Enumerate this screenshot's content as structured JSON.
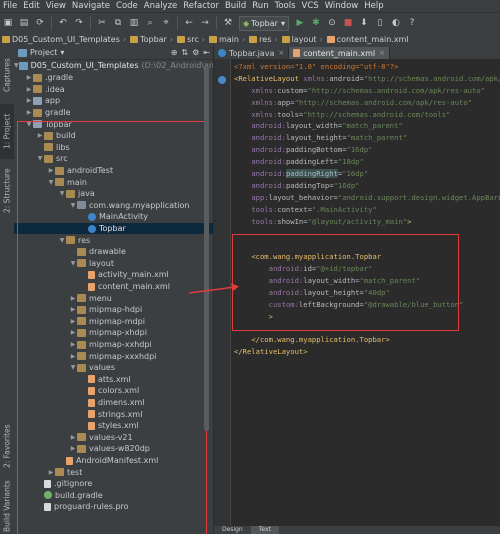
{
  "menubar": [
    "File",
    "Edit",
    "View",
    "Navigate",
    "Code",
    "Analyze",
    "Refactor",
    "Build",
    "Run",
    "Tools",
    "VCS",
    "Window",
    "Help"
  ],
  "toolbar": {
    "run_config": "Topbar"
  },
  "breadcrumbs": [
    "D05_Custom_UI_Templates",
    "Topbar",
    "src",
    "main",
    "res",
    "layout",
    "content_main.xml"
  ],
  "sidebar_tabs": [
    "Captures",
    "1: Project",
    "2: Structure",
    "2: Favorites",
    "Build Variants"
  ],
  "project_panel": {
    "header": "Project",
    "root": "D05_Custom_UI_Templates",
    "root_path": "(D:\\02_Android\\andr",
    "items": [
      {
        "label": ".gradle",
        "indent": 1,
        "open": false,
        "icon": "folder"
      },
      {
        "label": ".idea",
        "indent": 1,
        "open": false,
        "icon": "folder"
      },
      {
        "label": "app",
        "indent": 1,
        "open": false,
        "icon": "modfolder"
      },
      {
        "label": "gradle",
        "indent": 1,
        "open": false,
        "icon": "folder"
      },
      {
        "label": "Topbar",
        "indent": 1,
        "open": true,
        "icon": "modfolder"
      },
      {
        "label": "build",
        "indent": 2,
        "open": false,
        "icon": "folder"
      },
      {
        "label": "libs",
        "indent": 2,
        "open": null,
        "icon": "folder"
      },
      {
        "label": "src",
        "indent": 2,
        "open": true,
        "icon": "folder"
      },
      {
        "label": "androidTest",
        "indent": 3,
        "open": false,
        "icon": "folder"
      },
      {
        "label": "main",
        "indent": 3,
        "open": true,
        "icon": "folder"
      },
      {
        "label": "java",
        "indent": 4,
        "open": true,
        "icon": "folder"
      },
      {
        "label": "com.wang.myapplication",
        "indent": 5,
        "open": true,
        "icon": "pkg"
      },
      {
        "label": "MainActivity",
        "indent": 6,
        "open": null,
        "icon": "cls"
      },
      {
        "label": "Topbar",
        "indent": 6,
        "open": null,
        "icon": "cls",
        "selected": true
      },
      {
        "label": "res",
        "indent": 4,
        "open": true,
        "icon": "folder"
      },
      {
        "label": "drawable",
        "indent": 5,
        "open": null,
        "icon": "folder"
      },
      {
        "label": "layout",
        "indent": 5,
        "open": true,
        "icon": "folder"
      },
      {
        "label": "activity_main.xml",
        "indent": 6,
        "open": null,
        "icon": "xml"
      },
      {
        "label": "content_main.xml",
        "indent": 6,
        "open": null,
        "icon": "xml"
      },
      {
        "label": "menu",
        "indent": 5,
        "open": false,
        "icon": "folder"
      },
      {
        "label": "mipmap-hdpi",
        "indent": 5,
        "open": false,
        "icon": "folder"
      },
      {
        "label": "mipmap-mdpi",
        "indent": 5,
        "open": false,
        "icon": "folder"
      },
      {
        "label": "mipmap-xhdpi",
        "indent": 5,
        "open": false,
        "icon": "folder"
      },
      {
        "label": "mipmap-xxhdpi",
        "indent": 5,
        "open": false,
        "icon": "folder"
      },
      {
        "label": "mipmap-xxxhdpi",
        "indent": 5,
        "open": false,
        "icon": "folder"
      },
      {
        "label": "values",
        "indent": 5,
        "open": true,
        "icon": "folder"
      },
      {
        "label": "atts.xml",
        "indent": 6,
        "open": null,
        "icon": "xml"
      },
      {
        "label": "colors.xml",
        "indent": 6,
        "open": null,
        "icon": "xml"
      },
      {
        "label": "dimens.xml",
        "indent": 6,
        "open": null,
        "icon": "xml"
      },
      {
        "label": "strings.xml",
        "indent": 6,
        "open": null,
        "icon": "xml"
      },
      {
        "label": "styles.xml",
        "indent": 6,
        "open": null,
        "icon": "xml"
      },
      {
        "label": "values-v21",
        "indent": 5,
        "open": false,
        "icon": "folder"
      },
      {
        "label": "values-w820dp",
        "indent": 5,
        "open": false,
        "icon": "folder"
      },
      {
        "label": "AndroidManifest.xml",
        "indent": 4,
        "open": null,
        "icon": "xml"
      },
      {
        "label": "test",
        "indent": 3,
        "open": false,
        "icon": "folder"
      },
      {
        "label": ".gitignore",
        "indent": 2,
        "open": null,
        "icon": "file"
      },
      {
        "label": "build.gradle",
        "indent": 2,
        "open": null,
        "icon": "gradle"
      },
      {
        "label": "proguard-rules.pro",
        "indent": 2,
        "open": null,
        "icon": "file"
      }
    ]
  },
  "editor": {
    "tabs": [
      {
        "label": "Topbar.java",
        "active": false
      },
      {
        "label": "content_main.xml",
        "active": true
      }
    ],
    "lines": [
      [
        [
          "pi",
          "<?xml version=\"1.0\" encoding=\"utf-8\"?>"
        ]
      ],
      [
        [
          "kw",
          "<RelativeLayout "
        ],
        [
          "ns",
          "xmlns:"
        ],
        [
          "at",
          "android"
        ],
        [
          "",
          "="
        ],
        [
          "val",
          "\"http://schemas.android.com/apk/res/"
        ]
      ],
      [
        [
          "",
          "    "
        ],
        [
          "ns",
          "xmlns:"
        ],
        [
          "at",
          "custom"
        ],
        [
          "",
          "="
        ],
        [
          "val",
          "\"http://schemas.android.com/apk/res-auto\""
        ]
      ],
      [
        [
          "",
          "    "
        ],
        [
          "ns",
          "xmlns:"
        ],
        [
          "at",
          "app"
        ],
        [
          "",
          "="
        ],
        [
          "val",
          "\"http://schemas.android.com/apk/res-auto\""
        ]
      ],
      [
        [
          "",
          "    "
        ],
        [
          "ns",
          "xmlns:"
        ],
        [
          "at",
          "tools"
        ],
        [
          "",
          "="
        ],
        [
          "val",
          "\"http://schemas.android.com/tools\""
        ]
      ],
      [
        [
          "",
          "    "
        ],
        [
          "ns",
          "android:"
        ],
        [
          "at",
          "layout_width"
        ],
        [
          "",
          "="
        ],
        [
          "val",
          "\"match_parent\""
        ]
      ],
      [
        [
          "",
          "    "
        ],
        [
          "ns",
          "android:"
        ],
        [
          "at",
          "layout_height"
        ],
        [
          "",
          "="
        ],
        [
          "val",
          "\"match_parent\""
        ]
      ],
      [
        [
          "",
          "    "
        ],
        [
          "ns",
          "android:"
        ],
        [
          "at",
          "paddingBottom"
        ],
        [
          "",
          "="
        ],
        [
          "val",
          "\"16dp\""
        ]
      ],
      [
        [
          "",
          "    "
        ],
        [
          "ns",
          "android:"
        ],
        [
          "at",
          "paddingLeft"
        ],
        [
          "",
          "="
        ],
        [
          "val",
          "\"18dp\""
        ]
      ],
      [
        [
          "",
          "    "
        ],
        [
          "ns",
          "android:"
        ],
        [
          "hl",
          "paddingRight"
        ],
        [
          "",
          "="
        ],
        [
          "val",
          "\"16dp\""
        ]
      ],
      [
        [
          "",
          "    "
        ],
        [
          "ns",
          "android:"
        ],
        [
          "at",
          "paddingTop"
        ],
        [
          "",
          "="
        ],
        [
          "val",
          "\"16dp\""
        ]
      ],
      [
        [
          "",
          "    "
        ],
        [
          "ns",
          "app:"
        ],
        [
          "at",
          "layout_behavior"
        ],
        [
          "",
          "="
        ],
        [
          "val",
          "\"android.support.design.widget.AppBarLayou"
        ]
      ],
      [
        [
          "",
          "    "
        ],
        [
          "ns",
          "tools:"
        ],
        [
          "at",
          "context"
        ],
        [
          "",
          "="
        ],
        [
          "val",
          "\".MainActivity\""
        ]
      ],
      [
        [
          "",
          "    "
        ],
        [
          "ns",
          "tools:"
        ],
        [
          "at",
          "showIn"
        ],
        [
          "",
          "="
        ],
        [
          "val",
          "\"@layout/activity_main\""
        ],
        [
          "kw",
          ">"
        ]
      ],
      [
        [
          "",
          ""
        ]
      ],
      [
        [
          "",
          ""
        ]
      ],
      [
        [
          "",
          "    "
        ],
        [
          "kw",
          "<com.wang.myapplication.Topbar"
        ]
      ],
      [
        [
          "",
          "        "
        ],
        [
          "ns",
          "android:"
        ],
        [
          "at",
          "id"
        ],
        [
          "",
          "="
        ],
        [
          "val",
          "\"@+id/topbar\""
        ]
      ],
      [
        [
          "",
          "        "
        ],
        [
          "ns",
          "android:"
        ],
        [
          "at",
          "layout_width"
        ],
        [
          "",
          "="
        ],
        [
          "val",
          "\"match_parent\""
        ]
      ],
      [
        [
          "",
          "        "
        ],
        [
          "ns",
          "android:"
        ],
        [
          "at",
          "layout_height"
        ],
        [
          "",
          "="
        ],
        [
          "val",
          "\"40dp\""
        ]
      ],
      [
        [
          "",
          "        "
        ],
        [
          "ns",
          "custom:"
        ],
        [
          "at",
          "leftBackground"
        ],
        [
          "",
          "="
        ],
        [
          "val",
          "\"@drawable/blue_button\""
        ]
      ],
      [
        [
          "",
          "        "
        ],
        [
          "kw",
          ">"
        ]
      ],
      [
        [
          "",
          ""
        ]
      ],
      [
        [
          "",
          "    "
        ],
        [
          "kw",
          "</com.wang.myapplication.Topbar>"
        ]
      ],
      [
        [
          "kw",
          "</RelativeLayout>"
        ]
      ]
    ],
    "bottom_tabs": [
      "Design",
      "Text"
    ]
  },
  "colors": {
    "annotation_red": "#e23b3b",
    "selection": "#0d293e",
    "accent_blue": "#3d85c6"
  }
}
